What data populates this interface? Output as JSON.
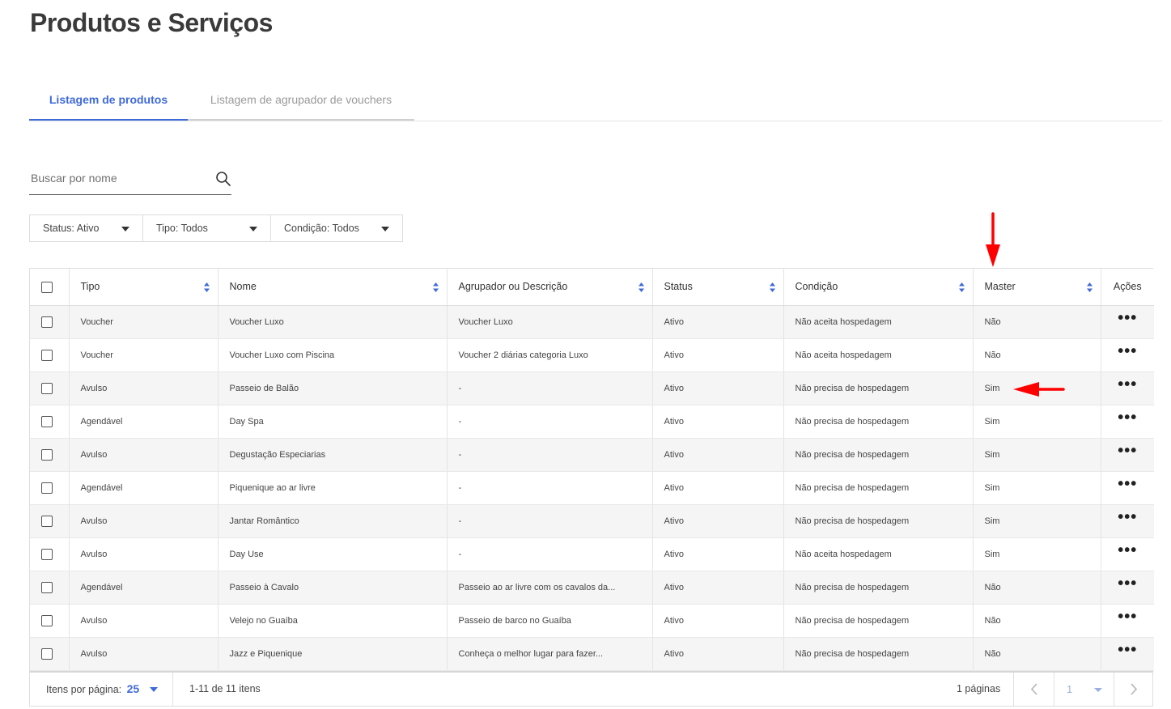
{
  "page": {
    "title": "Produtos e Serviços"
  },
  "tabs": [
    {
      "label": "Listagem de produtos",
      "active": true
    },
    {
      "label": "Listagem de agrupador de vouchers",
      "active": false
    }
  ],
  "search": {
    "placeholder": "Buscar por nome",
    "value": ""
  },
  "filters": {
    "status": "Status: Ativo",
    "tipo": "Tipo: Todos",
    "condicao": "Condição: Todos"
  },
  "table": {
    "headers": {
      "tipo": "Tipo",
      "nome": "Nome",
      "agrupador": "Agrupador ou Descrição",
      "status": "Status",
      "condicao": "Condição",
      "master": "Master",
      "acoes": "Ações"
    },
    "actions_glyph": "•••",
    "rows": [
      {
        "tipo": "Voucher",
        "nome": "Voucher Luxo",
        "agrupador": "Voucher Luxo",
        "status": "Ativo",
        "condicao": "Não aceita hospedagem",
        "master": "Não"
      },
      {
        "tipo": "Voucher",
        "nome": "Voucher Luxo com Piscina",
        "agrupador": "Voucher 2 diárias categoria Luxo",
        "status": "Ativo",
        "condicao": "Não aceita hospedagem",
        "master": "Não"
      },
      {
        "tipo": "Avulso",
        "nome": "Passeio de Balão",
        "agrupador": "-",
        "status": "Ativo",
        "condicao": "Não precisa de hospedagem",
        "master": "Sim"
      },
      {
        "tipo": "Agendável",
        "nome": "Day Spa",
        "agrupador": "-",
        "status": "Ativo",
        "condicao": "Não precisa de hospedagem",
        "master": "Sim"
      },
      {
        "tipo": "Avulso",
        "nome": "Degustação Especiarias",
        "agrupador": "-",
        "status": "Ativo",
        "condicao": "Não precisa de hospedagem",
        "master": "Sim"
      },
      {
        "tipo": "Agendável",
        "nome": "Piquenique ao ar livre",
        "agrupador": "-",
        "status": "Ativo",
        "condicao": "Não precisa de hospedagem",
        "master": "Sim"
      },
      {
        "tipo": "Avulso",
        "nome": "Jantar Romântico",
        "agrupador": "-",
        "status": "Ativo",
        "condicao": "Não precisa de hospedagem",
        "master": "Sim"
      },
      {
        "tipo": "Avulso",
        "nome": "Day Use",
        "agrupador": "-",
        "status": "Ativo",
        "condicao": "Não aceita hospedagem",
        "master": "Sim"
      },
      {
        "tipo": "Agendável",
        "nome": "Passeio à Cavalo",
        "agrupador": "Passeio ao ar livre com os cavalos da...",
        "status": "Ativo",
        "condicao": "Não precisa de hospedagem",
        "master": "Não"
      },
      {
        "tipo": "Avulso",
        "nome": "Velejo no Guaíba",
        "agrupador": "Passeio de barco no Guaíba",
        "status": "Ativo",
        "condicao": "Não precisa de hospedagem",
        "master": "Não"
      },
      {
        "tipo": "Avulso",
        "nome": "Jazz e Piquenique",
        "agrupador": "Conheça o melhor lugar para fazer...",
        "status": "Ativo",
        "condicao": "Não precisa de hospedagem",
        "master": "Não"
      }
    ]
  },
  "pagination": {
    "items_per_page_label": "Itens por página:",
    "items_per_page": "25",
    "range": "1-11 de 11 itens",
    "pages_label": "1 páginas",
    "current_page": "1"
  },
  "colors": {
    "accent": "#3f6ad8",
    "annotation_arrow": "#ff0000"
  },
  "icons": {
    "search": "search-icon",
    "sort": "sort-icon",
    "prev": "chevron-left-icon",
    "next": "chevron-right-icon",
    "dropdown": "caret-down-icon"
  }
}
